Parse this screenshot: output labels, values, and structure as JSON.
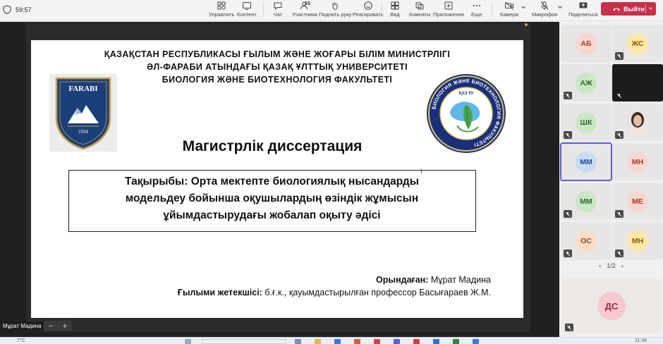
{
  "call": {
    "timer": "59:57"
  },
  "toolbar": {
    "manage": "Управлять",
    "content": "Контент",
    "chat": "Чат",
    "participants": "Участники",
    "participants_count": "15",
    "raise_hand": "Поднять руку",
    "react": "Реагировать",
    "view": "Вид",
    "rooms": "Комнаты",
    "apps": "Приложения",
    "more": "Еще",
    "camera": "Камера",
    "mic": "Микрофон",
    "share": "Поделиться",
    "leave": "Выйти"
  },
  "slide": {
    "header_line1": "ҚАЗАҚСТАН РЕСПУБЛИКАСЫ ҒЫЛЫМ ЖӘНЕ ЖОҒАРЫ БІЛІМ МИНИСТРЛІГІ",
    "header_line2": "ӘЛ-ФАРАБИ АТЫНДАҒЫ ҚАЗАҚ ҰЛТТЫҚ УНИВЕРСИТЕТІ",
    "header_line3": "БИОЛОГИЯ ЖӘНЕ БИОТЕХНОЛОГИЯ ФАКУЛЬТЕТІ",
    "left_logo_text": "FARABI",
    "left_logo_year": "1934",
    "right_logo_top": "ҚАЗ ҰУ",
    "right_logo_ring": "БИОЛОГИЯ ЖӘНЕ БИОТЕХНОЛОГИЯ ФАКУЛЬТЕТІ",
    "title": "Магистрлік диссертация",
    "topic_line1": "Тақырыбы: Орта мектепте биологиялық нысандарды",
    "topic_line2": "модельдеу бойынша оқушылардың өзіндік жұмысын",
    "topic_line3": "ұйымдастырудағы жобалап оқыту әдісі",
    "author_label": "Орындаған:",
    "author_name": " Мұрат Мадина",
    "supervisor_label": "Ғылыми жетекшісі:",
    "supervisor_name": " б.ғ.к., қауымдастырылған профессор Басығараев Ж.М."
  },
  "presenter": {
    "name": "Мұрат Мадина",
    "zoom_out": "−",
    "zoom_in": "+"
  },
  "participants": [
    {
      "initials": "АБ",
      "bg": "#f6d6d0",
      "fg": "#a23e2d",
      "muted": false
    },
    {
      "initials": "ЖС",
      "bg": "#fde7a9",
      "fg": "#8a5a00",
      "muted": true
    },
    {
      "initials": "АЖ",
      "bg": "#c9e6c5",
      "fg": "#2e6b28",
      "muted": true
    },
    {
      "initials": "",
      "bg": "#1c1c1c",
      "fg": "#ffffff",
      "muted": true
    },
    {
      "initials": "ШК",
      "bg": "#c9e6c5",
      "fg": "#2e6b28",
      "muted": true
    },
    {
      "initials": "",
      "bg": "#e8e6e4",
      "fg": "#000000",
      "muted": true
    },
    {
      "initials": "ММ",
      "bg": "#c8dcf3",
      "fg": "#1e4d8a",
      "muted": false
    },
    {
      "initials": "МН",
      "bg": "#f6d6d0",
      "fg": "#a23e2d",
      "muted": false
    },
    {
      "initials": "ММ",
      "bg": "#c9e6c5",
      "fg": "#2e6b28",
      "muted": true
    },
    {
      "initials": "МЕ",
      "bg": "#f6d6d0",
      "fg": "#a23e2d",
      "muted": true
    },
    {
      "initials": "ОС",
      "bg": "#fbdcc4",
      "fg": "#8a4613",
      "muted": true
    },
    {
      "initials": "МН",
      "bg": "#fde7a9",
      "fg": "#8a5a00",
      "muted": true
    }
  ],
  "pager": {
    "text": "1/2"
  },
  "featured": {
    "initials": "ДС",
    "bg": "#f6c9cf",
    "fg": "#a3243a",
    "muted": true
  },
  "taskbar": {
    "left": "7°C",
    "right": "11:34"
  },
  "colors": {
    "accent": "#5b5fc7",
    "leave": "#c4314b"
  }
}
